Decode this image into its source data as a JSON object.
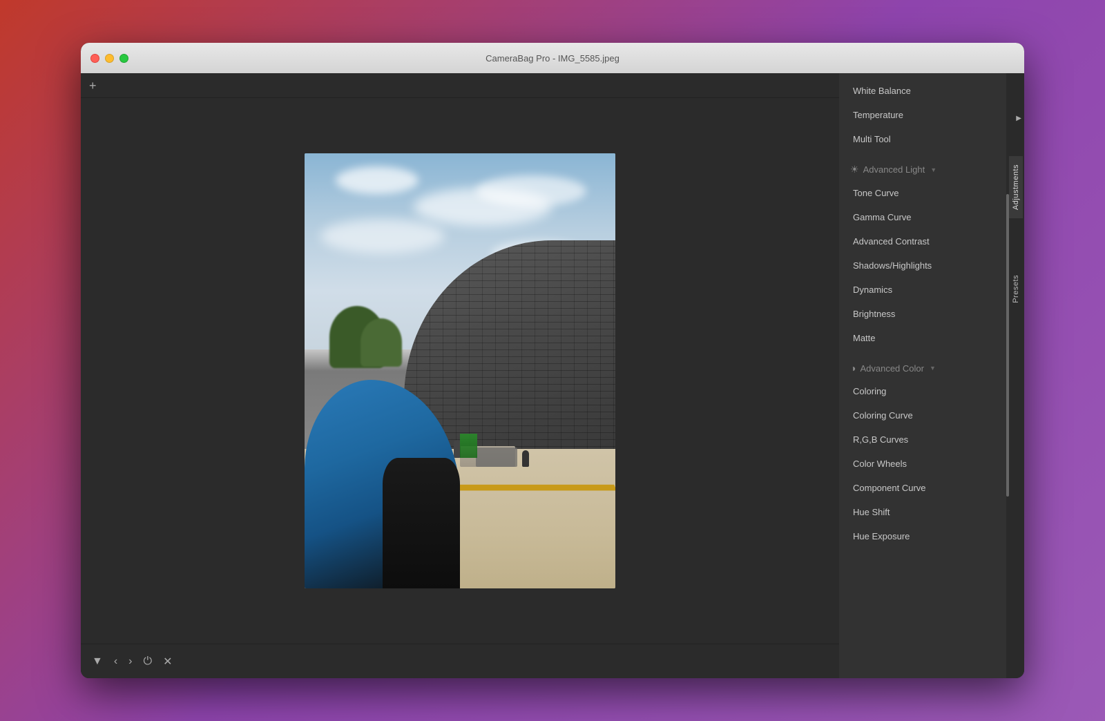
{
  "window": {
    "title": "CameraBag Pro - IMG_5585.jpeg"
  },
  "toolbar_bottom": {
    "arrow_down": "▼",
    "arrow_left": "‹",
    "arrow_right": "›",
    "power": "⏻",
    "close": "✕"
  },
  "right_panel": {
    "tabs": [
      {
        "id": "adjustments",
        "label": "Adjustments",
        "active": true
      },
      {
        "id": "presets",
        "label": "Presets",
        "active": false
      }
    ],
    "items_top": [
      {
        "id": "white-balance",
        "label": "White Balance"
      },
      {
        "id": "temperature",
        "label": "Temperature"
      },
      {
        "id": "multi-tool",
        "label": "Multi Tool"
      }
    ],
    "section_advanced_light": {
      "label": "Advanced Light",
      "icon": "☀",
      "items": [
        {
          "id": "tone-curve",
          "label": "Tone Curve"
        },
        {
          "id": "gamma-curve",
          "label": "Gamma Curve"
        },
        {
          "id": "advanced-contrast",
          "label": "Advanced Contrast"
        },
        {
          "id": "shadows-highlights",
          "label": "Shadows/Highlights"
        },
        {
          "id": "dynamics",
          "label": "Dynamics"
        },
        {
          "id": "brightness",
          "label": "Brightness"
        },
        {
          "id": "matte",
          "label": "Matte"
        }
      ]
    },
    "section_advanced_color": {
      "label": "Advanced Color",
      "icon": "◑",
      "items": [
        {
          "id": "coloring",
          "label": "Coloring"
        },
        {
          "id": "coloring-curve",
          "label": "Coloring Curve"
        },
        {
          "id": "rgb-curves",
          "label": "R,G,B Curves"
        },
        {
          "id": "color-wheels",
          "label": "Color Wheels"
        },
        {
          "id": "component-curve",
          "label": "Component Curve"
        },
        {
          "id": "hue-shift",
          "label": "Hue Shift"
        },
        {
          "id": "hue-exposure",
          "label": "Hue Exposure"
        }
      ]
    }
  }
}
